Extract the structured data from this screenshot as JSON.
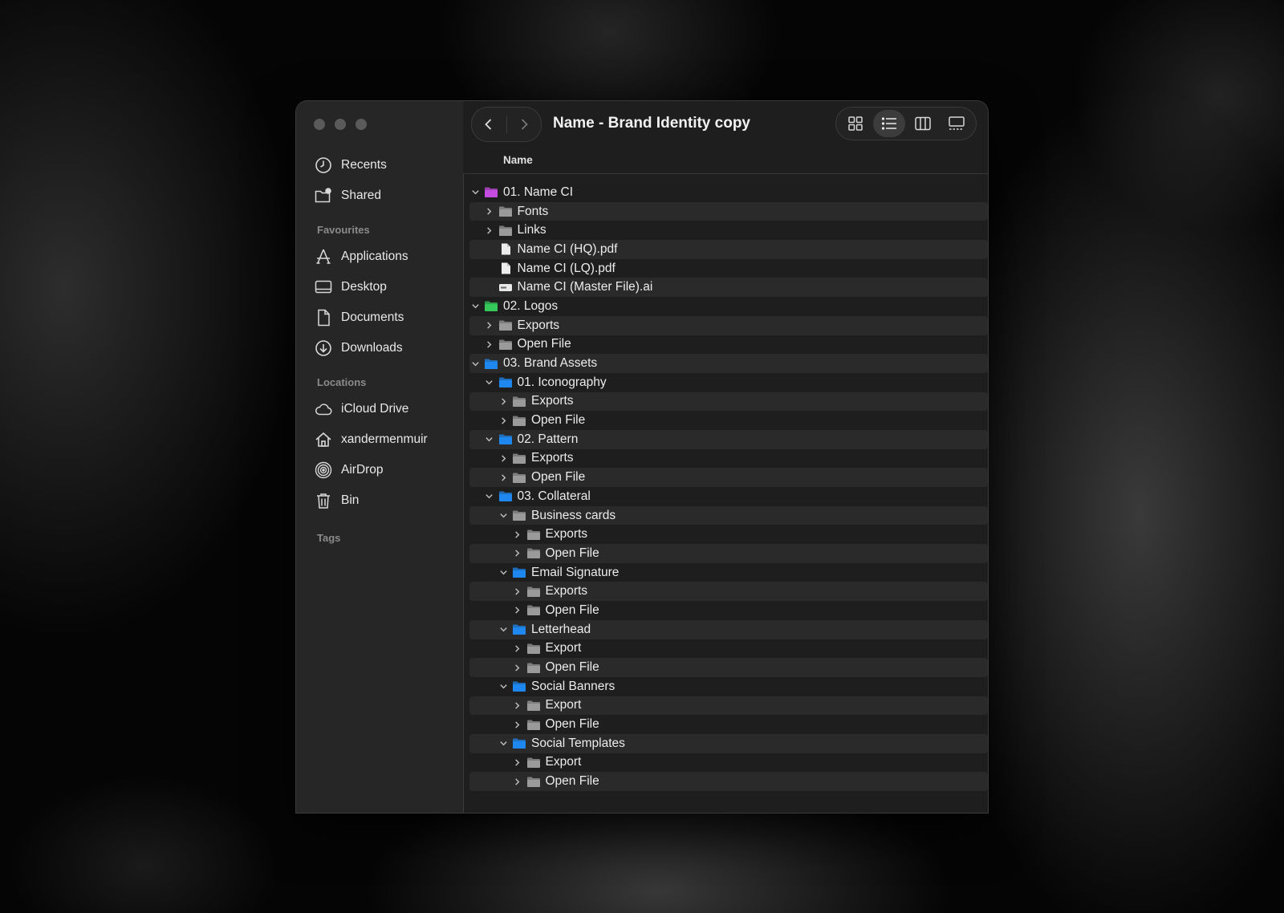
{
  "window": {
    "title": "Name - Brand Identity copy"
  },
  "sidebar": {
    "top": [
      {
        "label": "Recents",
        "icon": "clock-icon"
      },
      {
        "label": "Shared",
        "icon": "shared-folder-icon"
      }
    ],
    "favourites_header": "Favourites",
    "favourites": [
      {
        "label": "Applications",
        "icon": "applications-icon"
      },
      {
        "label": "Desktop",
        "icon": "desktop-icon"
      },
      {
        "label": "Documents",
        "icon": "document-icon"
      },
      {
        "label": "Downloads",
        "icon": "download-icon"
      }
    ],
    "locations_header": "Locations",
    "locations": [
      {
        "label": "iCloud Drive",
        "icon": "cloud-icon"
      },
      {
        "label": "xandermenmuir",
        "icon": "home-icon"
      },
      {
        "label": "AirDrop",
        "icon": "airdrop-icon"
      },
      {
        "label": "Bin",
        "icon": "trash-icon"
      }
    ],
    "tags_header": "Tags"
  },
  "list": {
    "column_name": "Name",
    "rows": [
      {
        "name": "01. Name CI",
        "level": 0,
        "type": "folder",
        "expanded": true,
        "color": "#c44ce0"
      },
      {
        "name": "Fonts",
        "level": 1,
        "type": "folder",
        "expanded": false,
        "color": "#9a9a9a"
      },
      {
        "name": "Links",
        "level": 1,
        "type": "folder",
        "expanded": false,
        "color": "#9a9a9a"
      },
      {
        "name": "Name CI (HQ).pdf",
        "level": 1,
        "type": "file"
      },
      {
        "name": "Name CI (LQ).pdf",
        "level": 1,
        "type": "file"
      },
      {
        "name": "Name CI (Master File).ai",
        "level": 1,
        "type": "ai"
      },
      {
        "name": "02. Logos",
        "level": 0,
        "type": "folder",
        "expanded": true,
        "color": "#34c759"
      },
      {
        "name": "Exports",
        "level": 1,
        "type": "folder",
        "expanded": false,
        "color": "#9a9a9a"
      },
      {
        "name": "Open File",
        "level": 1,
        "type": "folder",
        "expanded": false,
        "color": "#9a9a9a"
      },
      {
        "name": "03. Brand Assets",
        "level": 0,
        "type": "folder",
        "expanded": true,
        "color": "#1e88f0"
      },
      {
        "name": "01. Iconography",
        "level": 1,
        "type": "folder",
        "expanded": true,
        "color": "#1e88f0"
      },
      {
        "name": "Exports",
        "level": 2,
        "type": "folder",
        "expanded": false,
        "color": "#9a9a9a"
      },
      {
        "name": "Open File",
        "level": 2,
        "type": "folder",
        "expanded": false,
        "color": "#9a9a9a"
      },
      {
        "name": "02. Pattern",
        "level": 1,
        "type": "folder",
        "expanded": true,
        "color": "#1e88f0"
      },
      {
        "name": "Exports",
        "level": 2,
        "type": "folder",
        "expanded": false,
        "color": "#9a9a9a"
      },
      {
        "name": "Open File",
        "level": 2,
        "type": "folder",
        "expanded": false,
        "color": "#9a9a9a"
      },
      {
        "name": "03. Collateral",
        "level": 1,
        "type": "folder",
        "expanded": true,
        "color": "#1e88f0"
      },
      {
        "name": "Business cards",
        "level": 2,
        "type": "folder",
        "expanded": true,
        "color": "#9a9a9a"
      },
      {
        "name": "Exports",
        "level": 3,
        "type": "folder",
        "expanded": false,
        "color": "#9a9a9a"
      },
      {
        "name": "Open File",
        "level": 3,
        "type": "folder",
        "expanded": false,
        "color": "#9a9a9a"
      },
      {
        "name": "Email Signature",
        "level": 2,
        "type": "folder",
        "expanded": true,
        "color": "#1e88f0"
      },
      {
        "name": "Exports",
        "level": 3,
        "type": "folder",
        "expanded": false,
        "color": "#9a9a9a"
      },
      {
        "name": "Open File",
        "level": 3,
        "type": "folder",
        "expanded": false,
        "color": "#9a9a9a"
      },
      {
        "name": "Letterhead",
        "level": 2,
        "type": "folder",
        "expanded": true,
        "color": "#1e88f0"
      },
      {
        "name": "Export",
        "level": 3,
        "type": "folder",
        "expanded": false,
        "color": "#9a9a9a"
      },
      {
        "name": "Open File",
        "level": 3,
        "type": "folder",
        "expanded": false,
        "color": "#9a9a9a"
      },
      {
        "name": "Social Banners",
        "level": 2,
        "type": "folder",
        "expanded": true,
        "color": "#1e88f0"
      },
      {
        "name": "Export",
        "level": 3,
        "type": "folder",
        "expanded": false,
        "color": "#9a9a9a"
      },
      {
        "name": "Open File",
        "level": 3,
        "type": "folder",
        "expanded": false,
        "color": "#9a9a9a"
      },
      {
        "name": "Social Templates",
        "level": 2,
        "type": "folder",
        "expanded": true,
        "color": "#1e88f0"
      },
      {
        "name": "Export",
        "level": 3,
        "type": "folder",
        "expanded": false,
        "color": "#9a9a9a"
      },
      {
        "name": "Open File",
        "level": 3,
        "type": "folder",
        "expanded": false,
        "color": "#9a9a9a"
      }
    ]
  }
}
